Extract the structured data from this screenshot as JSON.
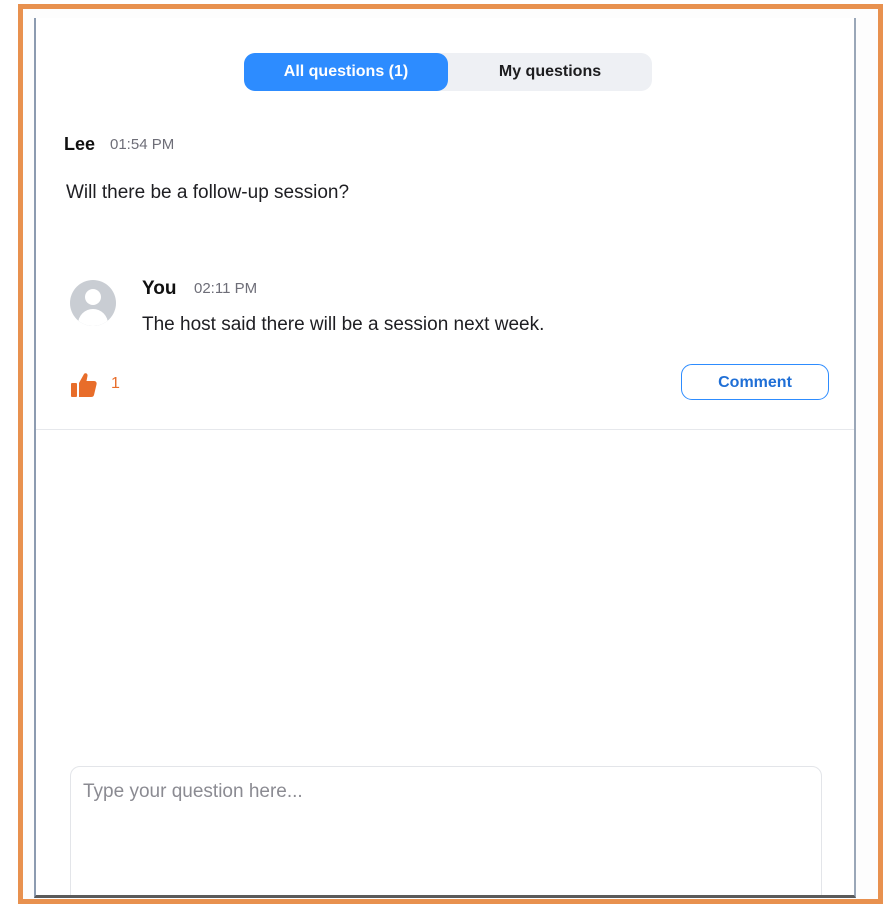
{
  "tabs": {
    "all_label": "All questions (1)",
    "my_label": "My questions"
  },
  "question": {
    "author": "Lee",
    "time": "01:54 PM",
    "text": "Will there be a follow-up session?"
  },
  "reply": {
    "author": "You",
    "time": "02:11 PM",
    "text": "The host said there will be a session next week."
  },
  "actions": {
    "upvote_icon": "thumbs-up-icon",
    "upvote_count": "1",
    "comment_label": "Comment"
  },
  "composer": {
    "placeholder": "Type your question here..."
  },
  "colors": {
    "frame_border": "#e8914f",
    "accent_blue": "#2d8cff",
    "upvote_orange": "#e86d2a"
  }
}
